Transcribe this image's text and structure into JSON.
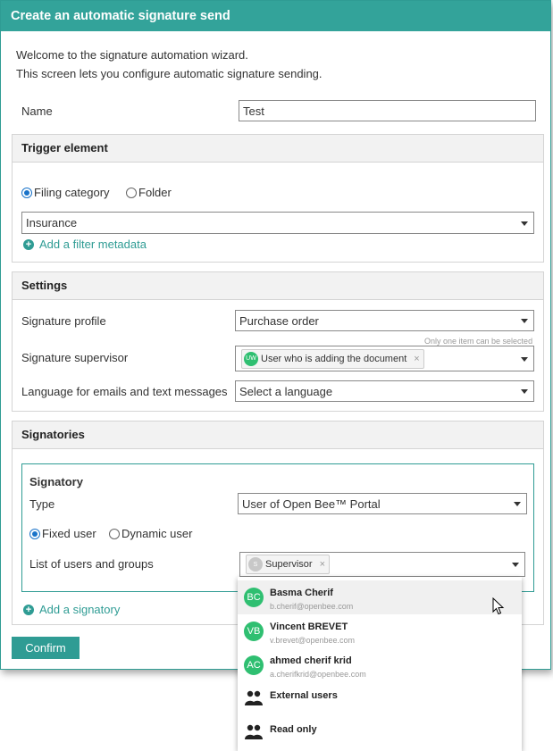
{
  "dialog": {
    "title": "Create an automatic signature send",
    "intro_line1": "Welcome to the signature automation wizard.",
    "intro_line2": "This screen lets you configure automatic signature sending.",
    "name_label": "Name",
    "name_value": "Test",
    "confirm_label": "Confirm"
  },
  "trigger": {
    "header": "Trigger element",
    "radio_filing": "Filing category",
    "radio_folder": "Folder",
    "selected": "filing",
    "category_value": "Insurance",
    "add_filter": "Add a filter metadata"
  },
  "settings": {
    "header": "Settings",
    "profile_label": "Signature profile",
    "profile_value": "Purchase order",
    "hint": "Only one item can be selected",
    "supervisor_label": "Signature supervisor",
    "supervisor_chip": "User who is adding the document",
    "supervisor_chip_initials": "UW",
    "language_label": "Language for emails and text messages",
    "language_value": "Select a language"
  },
  "signatories": {
    "header": "Signatories",
    "signatory_title": "Signatory",
    "type_label": "Type",
    "type_value": "User of Open Bee™ Portal",
    "radio_fixed": "Fixed user",
    "radio_dynamic": "Dynamic user",
    "list_label": "List of users and groups",
    "list_chip": "Supervisor",
    "list_chip_initials": "S",
    "add_signatory": "Add a signatory"
  },
  "dropdown": {
    "items": [
      {
        "initials": "BC",
        "name": "Basma Cherif",
        "email": "b.cherif@openbee.com"
      },
      {
        "initials": "VB",
        "name": "Vincent BREVET",
        "email": "v.brevet@openbee.com"
      },
      {
        "initials": "AC",
        "name": "ahmed cherif krid",
        "email": "a.cherifkrid@openbee.com"
      },
      {
        "name": "External users",
        "icon": "group-icon"
      },
      {
        "name": "Read only",
        "icon": "group-icon"
      }
    ]
  },
  "colors": {
    "accent": "#33a39a",
    "avatar_green": "#2fbf71",
    "radio_blue": "#1a73c9"
  }
}
